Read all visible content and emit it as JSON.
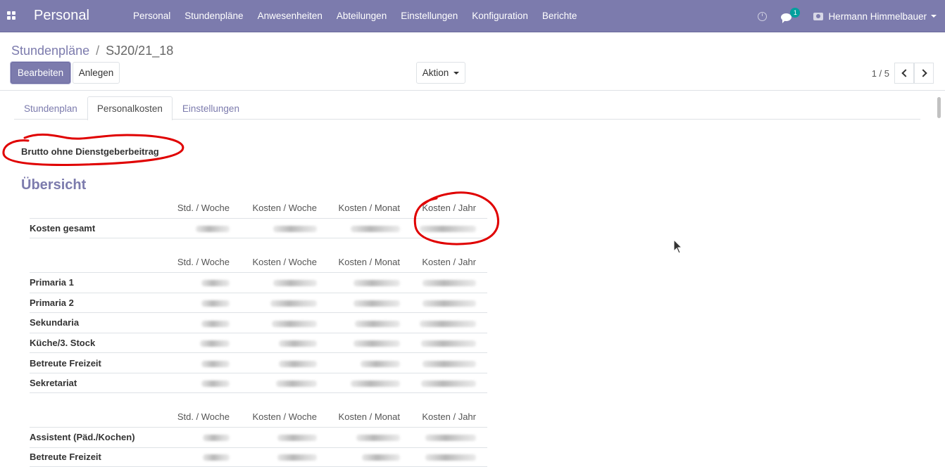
{
  "navbar": {
    "brand": "Personal",
    "menu": [
      "Personal",
      "Stundenpläne",
      "Anwesenheiten",
      "Abteilungen",
      "Einstellungen",
      "Konfiguration",
      "Berichte"
    ],
    "notification_count": "1",
    "user_name": "Hermann Himmelbauer"
  },
  "breadcrumb": {
    "parent": "Stundenpläne",
    "separator": "/",
    "current": "SJ20/21_18"
  },
  "buttons": {
    "edit": "Bearbeiten",
    "create": "Anlegen",
    "action": "Aktion"
  },
  "pager": {
    "value": "1 / 5"
  },
  "tabs": [
    {
      "label": "Stundenplan",
      "active": false
    },
    {
      "label": "Personalkosten",
      "active": true
    },
    {
      "label": "Einstellungen",
      "active": false
    }
  ],
  "brutto_label": "Brutto ohne Dienstgeberbeitrag",
  "section_title": "Übersicht",
  "columns": [
    "Std. / Woche",
    "Kosten / Woche",
    "Kosten / Monat",
    "Kosten / Jahr"
  ],
  "tables": [
    {
      "rows": [
        {
          "label": "Kosten gesamt"
        }
      ]
    },
    {
      "rows": [
        {
          "label": "Primaria 1"
        },
        {
          "label": "Primaria 2"
        },
        {
          "label": "Sekundaria"
        },
        {
          "label": "Küche/3. Stock"
        },
        {
          "label": "Betreute Freizeit"
        },
        {
          "label": "Sekretariat"
        }
      ]
    },
    {
      "rows": [
        {
          "label": "Assistent (Päd./Kochen)"
        },
        {
          "label": "Betreute Freizeit"
        }
      ]
    }
  ],
  "colors": {
    "primary": "#7c7bad",
    "annotation": "#e00000"
  }
}
